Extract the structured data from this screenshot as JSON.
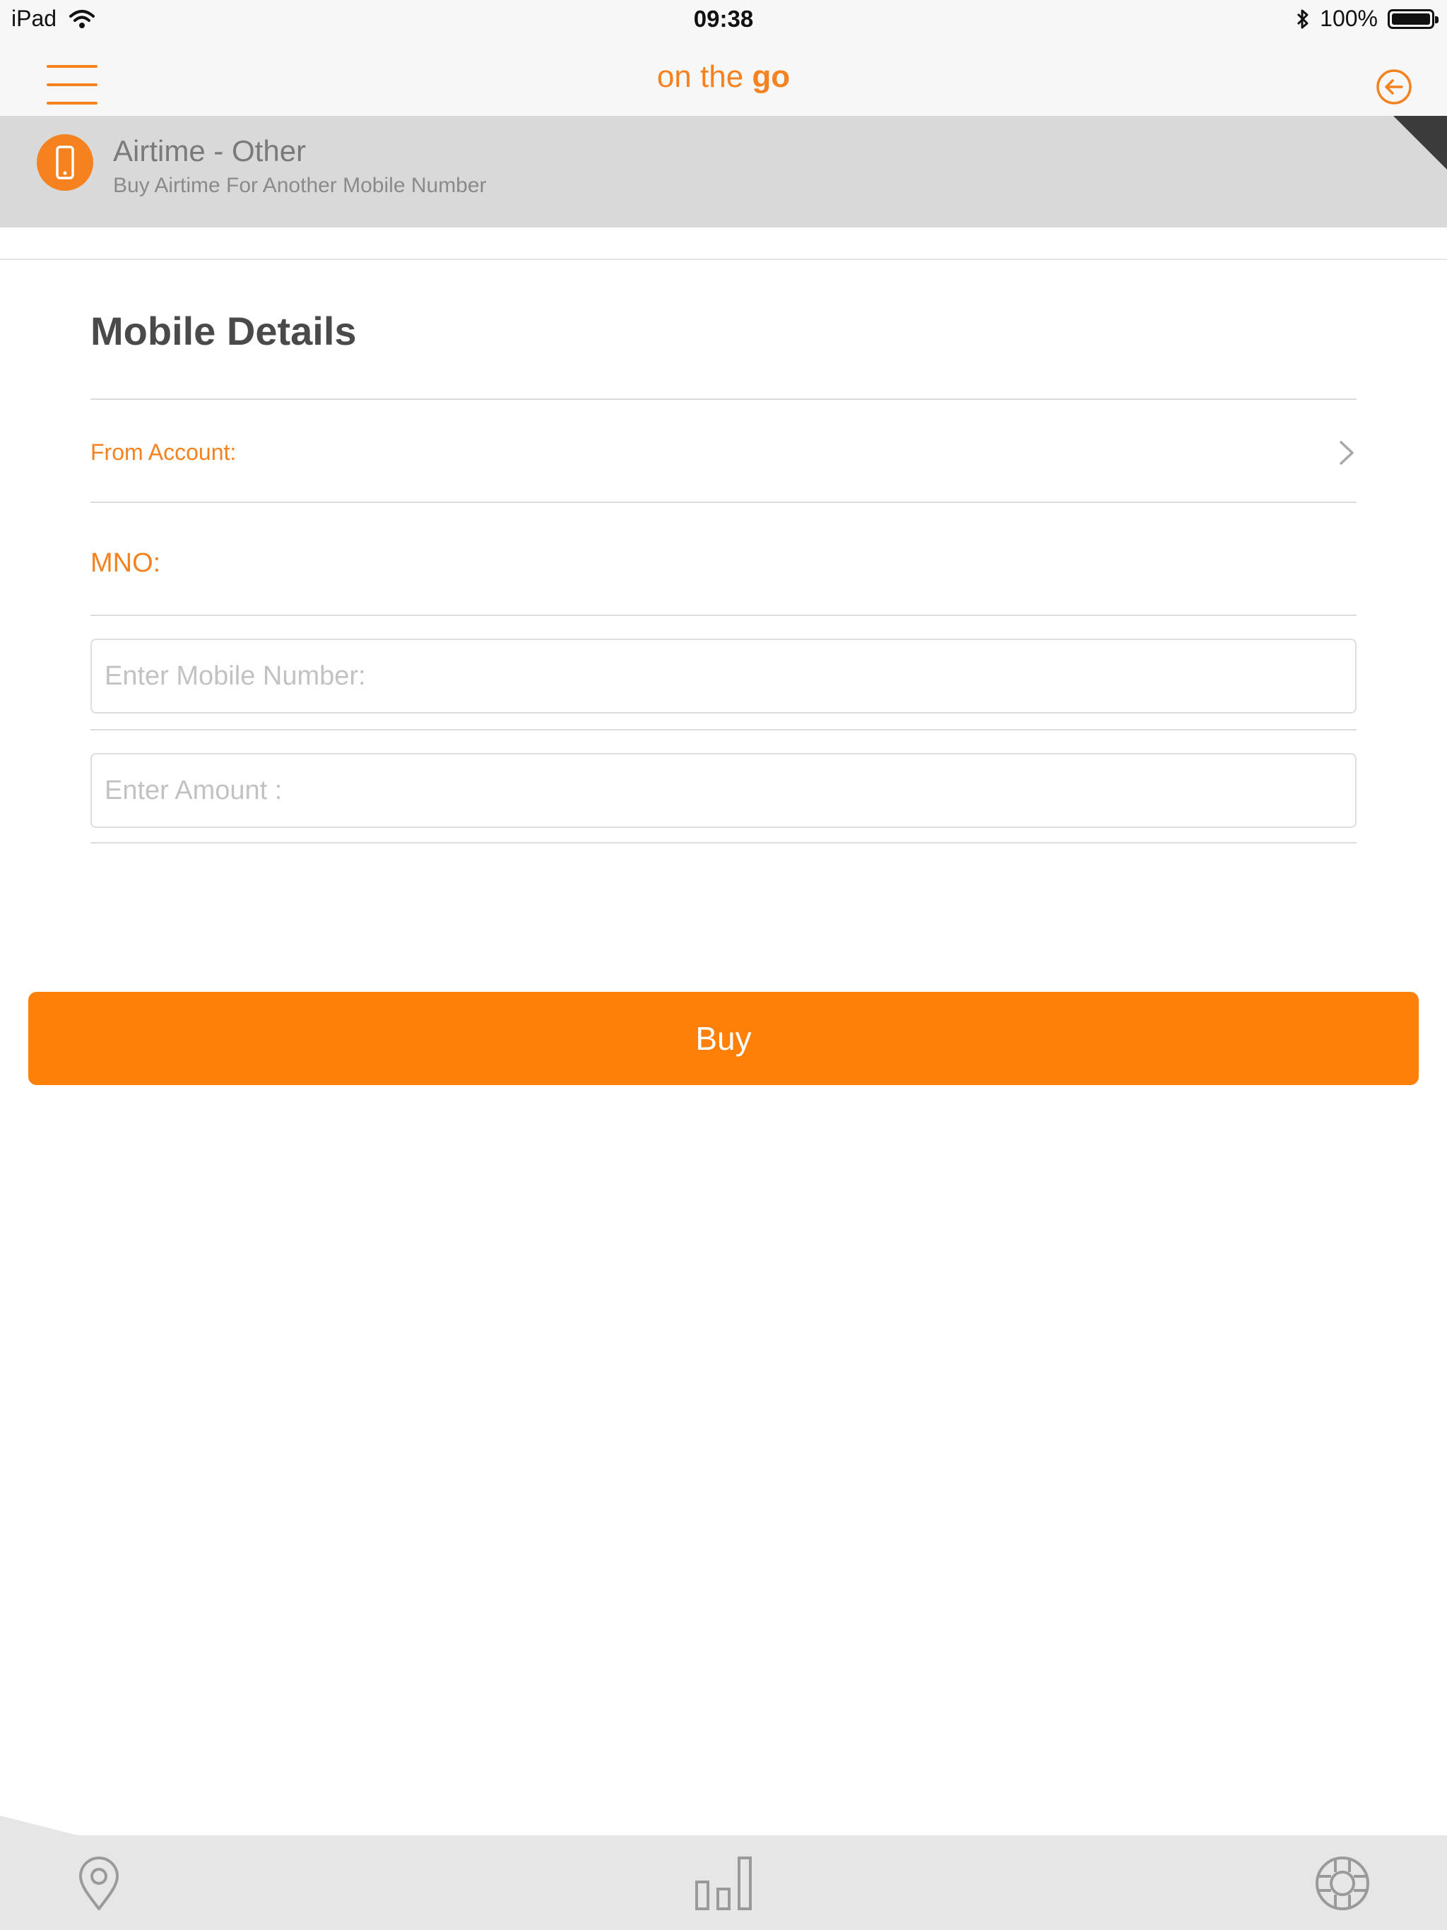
{
  "status_bar": {
    "device": "iPad",
    "time": "09:38",
    "battery": "100%",
    "icons": [
      "wifi-icon",
      "bluetooth-icon",
      "battery-icon"
    ]
  },
  "nav": {
    "brand_prefix": "on the ",
    "brand_bold": "go",
    "icons": [
      "hamburger-menu-icon",
      "back-arrow-icon"
    ]
  },
  "header": {
    "title": "Airtime - Other",
    "subtitle": "Buy Airtime For Another Mobile Number",
    "icon": "mobile-phone-icon"
  },
  "form": {
    "section_title": "Mobile Details",
    "from_account_label": "From Account:",
    "mno_label": "MNO:",
    "mobile_number": {
      "placeholder": "Enter Mobile Number:",
      "value": ""
    },
    "amount": {
      "placeholder": "Enter Amount :",
      "value": ""
    },
    "buy_label": "Buy"
  },
  "tab_bar": {
    "icons": [
      "location-pin-icon",
      "bar-chart-icon",
      "help-lifebuoy-icon"
    ]
  },
  "colors": {
    "accent": "#f5821f",
    "button": "#ff8008",
    "header_band": "#d9d9d9",
    "tab_bar": "#e6e6e6"
  }
}
